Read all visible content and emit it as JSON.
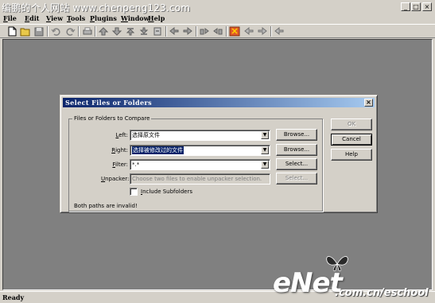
{
  "window": {
    "watermark": "编鹏的个人网站   www.chenpeng123.com",
    "min_glyph": "_",
    "max_glyph": "□",
    "close_glyph": "×"
  },
  "menu": [
    "File",
    "Edit",
    "View",
    "Tools",
    "Plugins",
    "Window",
    "Help"
  ],
  "toolbar_icons": [
    "new-icon",
    "open-icon",
    "save-icon",
    "undo-icon",
    "redo-icon",
    "print-icon",
    "prev-diff-icon",
    "next-diff-icon",
    "first-diff-icon",
    "last-diff-icon",
    "current-diff-icon",
    "copy-left-icon",
    "copy-right-icon",
    "copy-all-left-icon",
    "copy-all-right-icon",
    "refresh-icon",
    "options-icon",
    "previous-icon",
    "next-icon",
    "help-icon"
  ],
  "status": {
    "text": "Ready"
  },
  "dialog": {
    "title": "Select Files or Folders",
    "close_glyph": "×",
    "group_label": "Files or Folders to Compare",
    "left_label": "Left:",
    "left_value": "选择原文件",
    "right_label": "Right:",
    "right_value": "选择被修改过的文件",
    "filter_label": "Filter:",
    "filter_value": "*.*",
    "unpacker_label": "Unpacker:",
    "unpacker_placeholder": "Choose two files to enable unpacker selection.",
    "browse_label": "Browse...",
    "select_label": "Select...",
    "select_disabled_label": "Select...",
    "ok_label": "OK",
    "cancel_label": "Cancel",
    "help_label": "Help",
    "include_subfolders_label": "Include Subfolders",
    "include_subfolders_checked": false,
    "status_message": "Both paths are invalid!"
  },
  "logo": {
    "brand": "eNet",
    "url": ".com.cn/eschool"
  },
  "colors": {
    "chrome": "#d4d0c8",
    "workspace": "#808080",
    "title_active": "#0a246a",
    "title_gradient_end": "#a6caf0",
    "selection": "#0a246a"
  }
}
